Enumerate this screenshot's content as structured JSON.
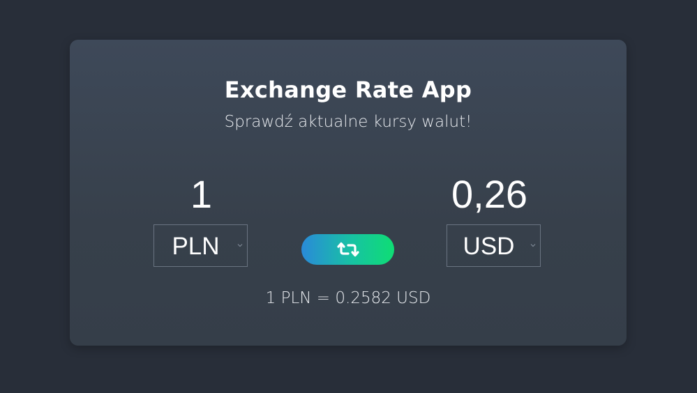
{
  "app": {
    "title": "Exchange Rate App",
    "subtitle": "Sprawdź aktualne kursy walut!"
  },
  "converter": {
    "from": {
      "amount": "1",
      "currency": "PLN"
    },
    "to": {
      "amount": "0,26",
      "currency": "USD"
    },
    "swap_icon": "swap-arrows-icon",
    "rate_text": "1 PLN = 0.2582 USD"
  },
  "colors": {
    "background": "#282e39",
    "card": "#3b4553",
    "swap_gradient_start": "#2a8ad9",
    "swap_gradient_end": "#0fdd74"
  }
}
